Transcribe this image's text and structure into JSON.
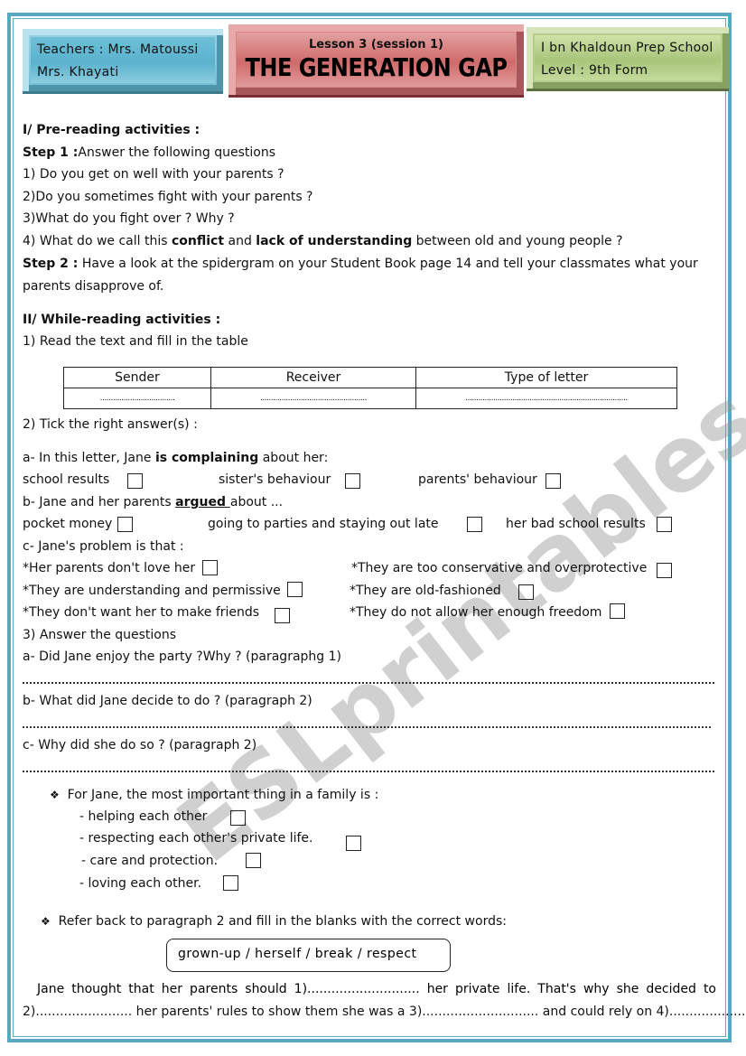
{
  "header": {
    "teachers_line1": "Teachers : Mrs. Matoussi",
    "teachers_line2": "Mrs. Khayati",
    "lesson": "Lesson 3 (session 1)",
    "title": "THE GENERATION GAP",
    "school": "I bn Khaldoun Prep School",
    "level": "Level : 9th Form"
  },
  "pre_reading": {
    "heading": "I/ Pre-reading activities :",
    "step1_label": "Step 1 :",
    "step1_text": "Answer the following questions",
    "q1": "1) Do you get on well with your parents ?",
    "q2": "2)Do you sometimes fight with your parents ?",
    "q3": "3)What do you fight over ? Why ?",
    "q4_a": "4) What do we call this ",
    "q4_b": "conflict",
    "q4_c": " and ",
    "q4_d": "lack of understanding",
    "q4_e": " between old and young people ?",
    "step2_label": "Step 2 :",
    "step2_text": " Have a look at the spidergram on your Student Book page 14 and tell your classmates what your",
    "step2_text2": "parents disapprove of."
  },
  "while_reading": {
    "heading": "II/ While-reading activities :",
    "task1": "1) Read the text and fill in the table",
    "table": {
      "headers": [
        "Sender",
        "Receiver",
        "Type of letter"
      ],
      "blanks": [
        "...................................",
        "..................................................",
        "............................................................................"
      ]
    },
    "task2": "2) Tick the right answer(s) :",
    "a_prefix": "a- In this letter, Jane ",
    "a_bold": "is complaining",
    "a_suffix": " about her:",
    "a_options": [
      "school results",
      "sister's behaviour",
      "parents' behaviour"
    ],
    "b_prefix": "b-  Jane and her parents ",
    "b_bold": "argued ",
    "b_suffix": "about ...",
    "b_options": [
      "pocket money",
      "going to parties and staying out late",
      "her bad school results"
    ],
    "c_heading": "c- Jane's problem is that :",
    "c_options_left": [
      "*Her parents don't love her",
      "*They are understanding and permissive",
      "*They don't want her to make friends"
    ],
    "c_options_right": [
      "*They are too conservative and overprotective",
      "*They are old-fashioned",
      "*They do not allow her enough freedom"
    ],
    "task3": "3) Answer the questions",
    "q_a": "a- Did Jane enjoy the party ?Why ? (paragraphg 1)",
    "q_b": "b- What did Jane decide to do ? (paragraph 2)",
    "q_c": "c- Why did she do so ? (paragraph 2)"
  },
  "family": {
    "bullet": "❖",
    "heading": "For Jane, the most important thing in a family is :",
    "options": [
      "-  helping each other",
      "-  respecting each other's private life.",
      "-  care and protection.",
      "- loving each other."
    ]
  },
  "refer": {
    "bullet": "❖",
    "heading": "Refer back to paragraph 2 and fill in the blanks with the correct words:",
    "words": "grown-up /  herself  /  break  /  respect",
    "line1": "Jane thought that her parents should 1)............................ her private life. That's why she decided to",
    "line2": "2)........................ her parents' rules to show them she was a 3)............................. and could rely on 4).............................."
  },
  "watermark": "ESLprintables.com"
}
